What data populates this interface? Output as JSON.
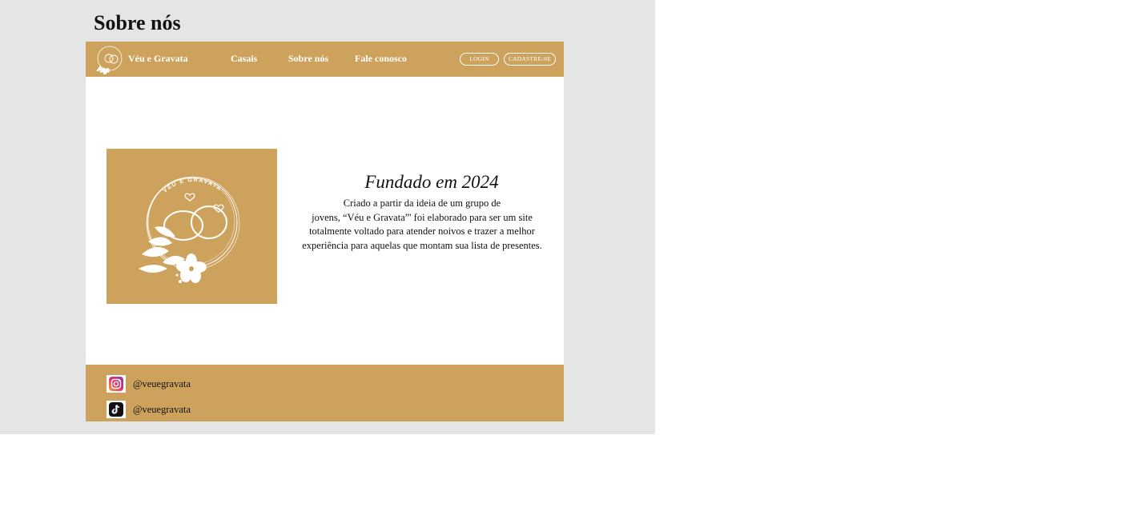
{
  "frame": {
    "title": "Sobre nós"
  },
  "navbar": {
    "brand": "Véu e Gravata",
    "links": [
      "Casais",
      "Sobre nós",
      "Fale conosco"
    ],
    "login_label": "LOGIN",
    "signup_label": "CADASTRE-SE",
    "logo_icon": "rings-flower-logo-icon"
  },
  "about": {
    "heading": "Fundado em 2024",
    "lines": [
      "Criado a partir da ideia de um grupo de",
      "jovens, “Véu e Gravata”' foi elaborado para ser um site",
      "totalmente voltado para atender noivos e trazer a melhor",
      "experiência para aquelas que montam sua lista de presentes."
    ],
    "image_badge_text": "VÉU E GRAVATA"
  },
  "footer": {
    "socials": [
      {
        "icon": "instagram-icon",
        "handle": "@veuegravata"
      },
      {
        "icon": "tiktok-icon",
        "handle": "@veuegravata"
      }
    ]
  },
  "colors": {
    "brand_gold": "#cda25c",
    "frame_gray": "#e5e5e5",
    "text_dark": "#111111",
    "white": "#ffffff"
  }
}
